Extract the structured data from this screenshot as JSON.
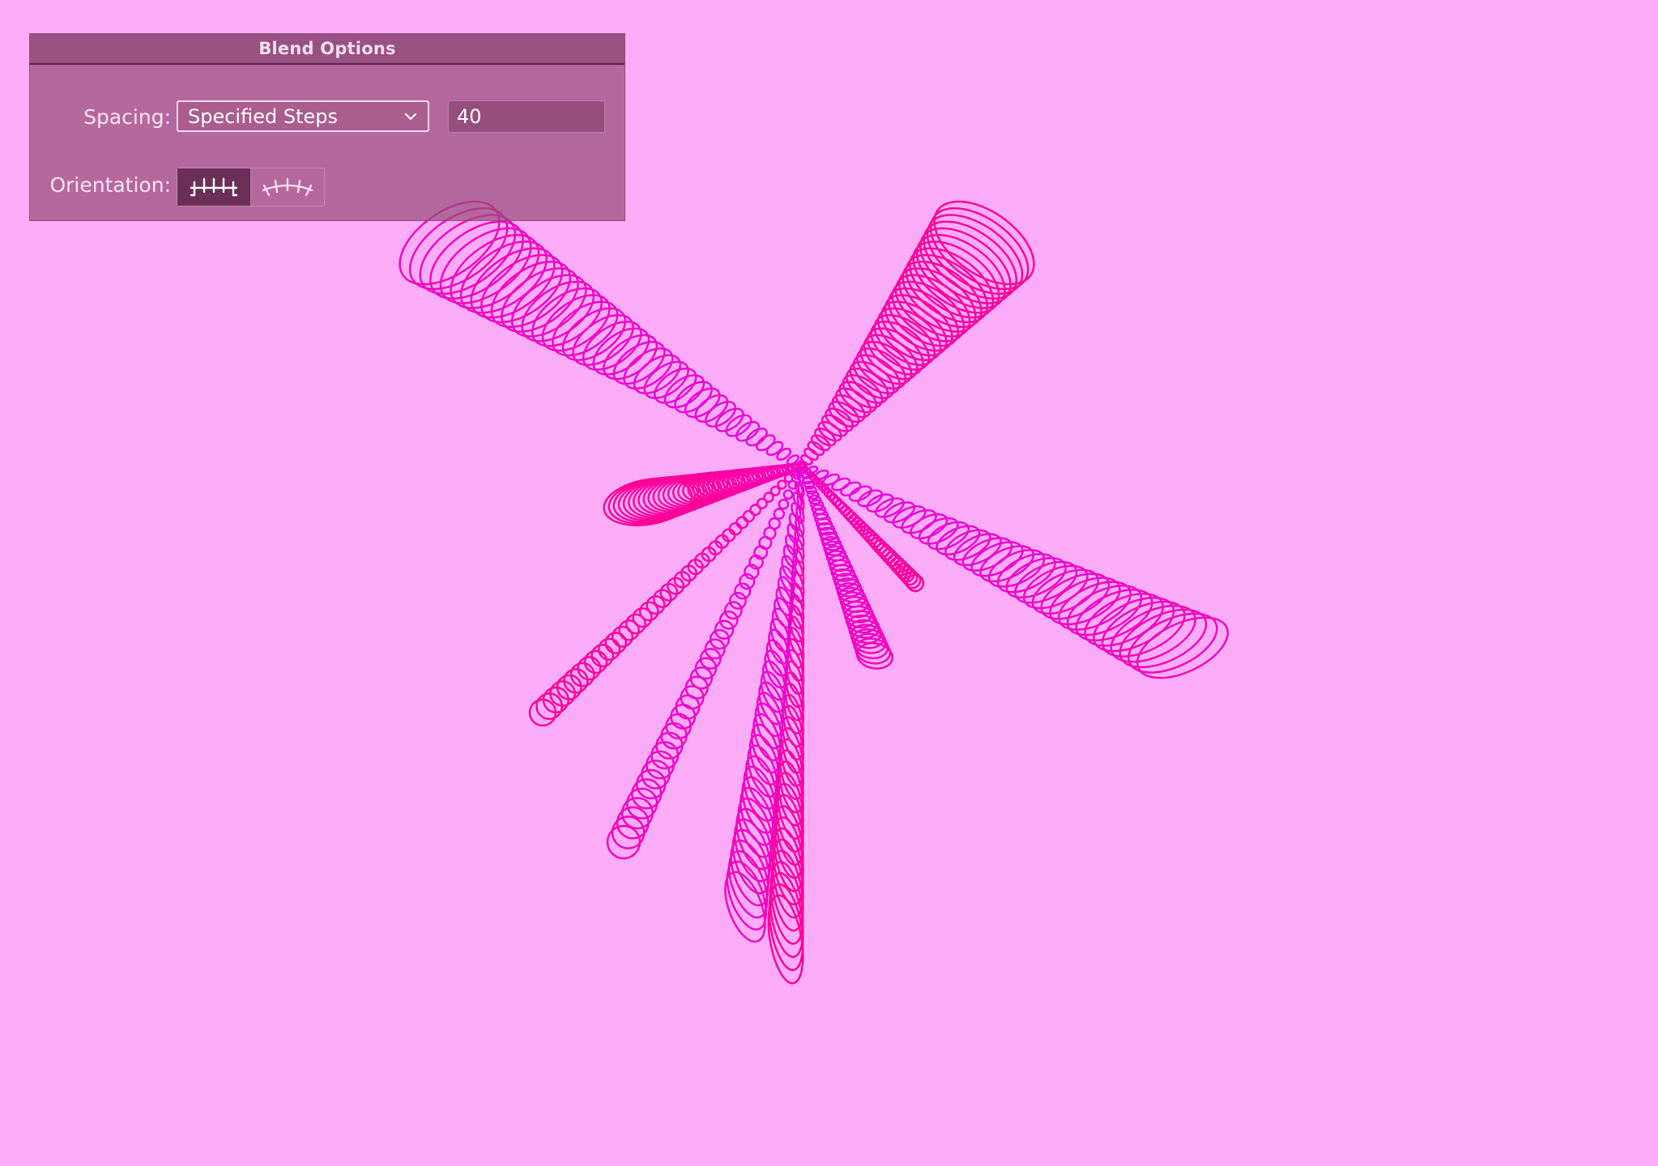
{
  "app": {
    "background_color": "#FDACF8",
    "accent_colors": [
      "#FF00B0",
      "#E800E0"
    ]
  },
  "dialog": {
    "title": "Blend Options",
    "spacing": {
      "label": "Spacing:",
      "selected": "Specified Steps",
      "steps_value": "40"
    },
    "orientation": {
      "label": "Orientation:",
      "options": [
        {
          "name": "align-to-page",
          "icon": "align-to-page-icon",
          "selected": true
        },
        {
          "name": "align-to-path",
          "icon": "align-to-path-icon",
          "selected": false
        }
      ]
    }
  },
  "artwork": {
    "description_icon": "blend-artwork",
    "steps": 40
  }
}
